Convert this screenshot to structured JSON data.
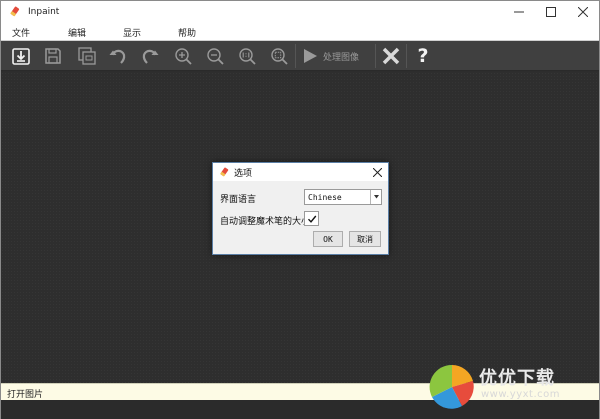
{
  "window": {
    "title": "Inpaint",
    "minimize_icon": "minimize-icon",
    "maximize_icon": "maximize-icon",
    "close_icon": "close-icon"
  },
  "menu": {
    "items": [
      {
        "label": "文件"
      },
      {
        "label": "编辑"
      },
      {
        "label": "显示"
      },
      {
        "label": "帮助"
      }
    ]
  },
  "toolbar": {
    "buttons": [
      {
        "icon": "open-file-icon"
      },
      {
        "icon": "save-icon"
      },
      {
        "icon": "save-copy-icon"
      },
      {
        "icon": "undo-icon"
      },
      {
        "icon": "redo-icon"
      },
      {
        "icon": "zoom-in-icon"
      },
      {
        "icon": "zoom-out-icon"
      },
      {
        "icon": "actual-size-icon"
      },
      {
        "icon": "fit-window-icon"
      }
    ],
    "process_label": "处理图像",
    "help_label": "?"
  },
  "dialog": {
    "title": "选项",
    "language_label": "界面语言",
    "language_value": "Chinese",
    "auto_adjust_label": "自动调整魔术笔的大小",
    "auto_adjust_checked": true,
    "ok_label": "OK",
    "cancel_label": "取消"
  },
  "status": {
    "text": "打开图片"
  },
  "watermark": {
    "text": "优优下载",
    "url": "www.yyxt.com"
  },
  "colors": {
    "toolbar_bg": "#404040",
    "canvas_bg": "#2e2e2e",
    "status_bg": "#fdfbe5",
    "dialog_border": "#5b7fa6"
  }
}
